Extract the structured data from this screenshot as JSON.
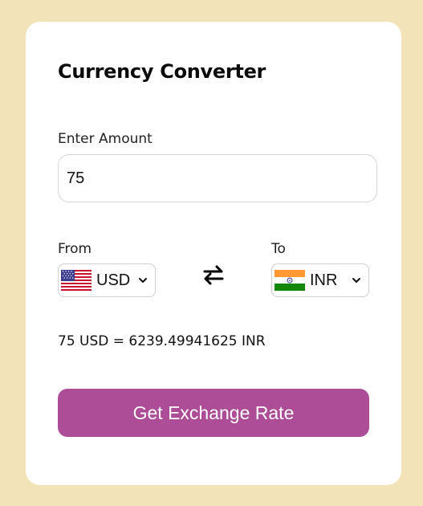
{
  "title": "Currency Converter",
  "amount": {
    "label": "Enter Amount",
    "value": "75"
  },
  "from": {
    "label": "From",
    "currency": "USD",
    "flag_icon": "us-flag-icon"
  },
  "to": {
    "label": "To",
    "currency": "INR",
    "flag_icon": "india-flag-icon"
  },
  "swap_icon": "swap-arrows-icon",
  "result": "75 USD = 6239.49941625 INR",
  "button": {
    "label": "Get Exchange Rate"
  },
  "colors": {
    "page_background": "#f3e3b8",
    "card_background": "#ffffff",
    "button_background": "#ad4d97",
    "button_text": "#ffffff"
  }
}
